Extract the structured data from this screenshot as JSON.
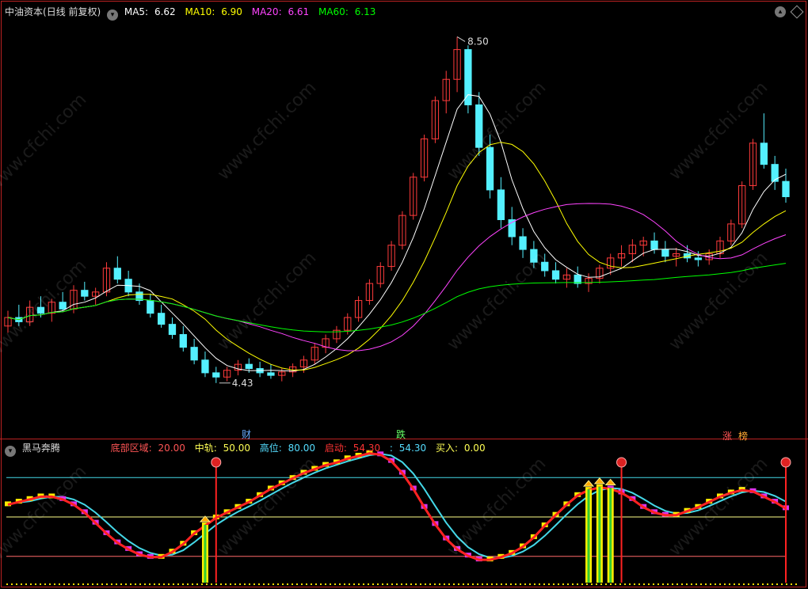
{
  "upper": {
    "title": "中油资本",
    "mode": "(日线 前复权)",
    "ma": [
      {
        "label": "MA5:",
        "value": "6.62",
        "color": "#ffffff"
      },
      {
        "label": "MA10:",
        "value": "6.90",
        "color": "#ffff00"
      },
      {
        "label": "MA20:",
        "value": "6.61",
        "color": "#ff44ff"
      },
      {
        "label": "MA60:",
        "value": "6.13",
        "color": "#00ff00"
      }
    ],
    "annotations": {
      "high": "8.50",
      "low": "4.43"
    },
    "markers": [
      "财",
      "跌",
      "涨",
      "榜"
    ]
  },
  "lower": {
    "title": "黑马奔腾",
    "params": [
      {
        "label": "底部区域:",
        "value": "20.00",
        "color": "#ff5555"
      },
      {
        "label": "中轨:",
        "value": "50.00",
        "color": "#ffff55"
      },
      {
        "label": "高位:",
        "value": "80.00",
        "color": "#55ddff"
      },
      {
        "label": "启动:",
        "value": "54.30",
        "color": "#ff3333"
      },
      {
        "label": ":",
        "value": "54.30",
        "color": "#55ddff"
      },
      {
        "label": "买入:",
        "value": "0.00",
        "color": "#ffff55"
      }
    ]
  },
  "watermark": "www.cfchi.com",
  "chart_data": [
    {
      "type": "candlestick",
      "title": "中油资本 (日线 前复权)",
      "ylim": [
        4.0,
        8.7
      ],
      "annotations": [
        {
          "label": "8.50",
          "value": 8.5
        },
        {
          "label": "4.43",
          "value": 4.43
        }
      ],
      "ohlc": [
        [
          5.1,
          5.28,
          5.02,
          5.2
        ],
        [
          5.2,
          5.35,
          5.1,
          5.15
        ],
        [
          5.15,
          5.4,
          5.1,
          5.32
        ],
        [
          5.32,
          5.45,
          5.2,
          5.25
        ],
        [
          5.25,
          5.42,
          5.15,
          5.38
        ],
        [
          5.38,
          5.5,
          5.28,
          5.3
        ],
        [
          5.3,
          5.58,
          5.25,
          5.52
        ],
        [
          5.52,
          5.62,
          5.4,
          5.45
        ],
        [
          5.45,
          5.55,
          5.35,
          5.5
        ],
        [
          5.5,
          5.85,
          5.45,
          5.78
        ],
        [
          5.78,
          5.92,
          5.6,
          5.65
        ],
        [
          5.65,
          5.75,
          5.45,
          5.5
        ],
        [
          5.5,
          5.6,
          5.35,
          5.4
        ],
        [
          5.4,
          5.48,
          5.2,
          5.25
        ],
        [
          5.25,
          5.35,
          5.08,
          5.12
        ],
        [
          5.12,
          5.2,
          4.95,
          5.0
        ],
        [
          5.0,
          5.1,
          4.8,
          4.85
        ],
        [
          4.85,
          4.95,
          4.65,
          4.7
        ],
        [
          4.7,
          4.8,
          4.5,
          4.55
        ],
        [
          4.55,
          4.62,
          4.43,
          4.5
        ],
        [
          4.5,
          4.62,
          4.45,
          4.58
        ],
        [
          4.58,
          4.7,
          4.52,
          4.65
        ],
        [
          4.65,
          4.72,
          4.55,
          4.6
        ],
        [
          4.6,
          4.68,
          4.5,
          4.55
        ],
        [
          4.55,
          4.65,
          4.48,
          4.52
        ],
        [
          4.52,
          4.6,
          4.45,
          4.56
        ],
        [
          4.56,
          4.66,
          4.5,
          4.62
        ],
        [
          4.62,
          4.75,
          4.55,
          4.7
        ],
        [
          4.7,
          4.9,
          4.65,
          4.85
        ],
        [
          4.85,
          5.0,
          4.78,
          4.95
        ],
        [
          4.95,
          5.1,
          4.9,
          5.05
        ],
        [
          5.05,
          5.25,
          5.0,
          5.2
        ],
        [
          5.2,
          5.45,
          5.15,
          5.4
        ],
        [
          5.4,
          5.65,
          5.35,
          5.6
        ],
        [
          5.6,
          5.85,
          5.55,
          5.8
        ],
        [
          5.8,
          6.1,
          5.75,
          6.05
        ],
        [
          6.05,
          6.45,
          6.0,
          6.4
        ],
        [
          6.4,
          6.9,
          6.35,
          6.85
        ],
        [
          6.85,
          7.35,
          6.8,
          7.3
        ],
        [
          7.3,
          7.8,
          7.25,
          7.75
        ],
        [
          7.75,
          8.1,
          7.6,
          8.0
        ],
        [
          8.0,
          8.5,
          7.85,
          8.35
        ],
        [
          8.35,
          8.4,
          7.6,
          7.7
        ],
        [
          7.7,
          7.85,
          7.1,
          7.2
        ],
        [
          7.2,
          7.35,
          6.6,
          6.7
        ],
        [
          6.7,
          6.85,
          6.25,
          6.35
        ],
        [
          6.35,
          6.5,
          6.05,
          6.15
        ],
        [
          6.15,
          6.25,
          5.9,
          6.0
        ],
        [
          6.0,
          6.1,
          5.78,
          5.85
        ],
        [
          5.85,
          5.95,
          5.68,
          5.75
        ],
        [
          5.75,
          5.85,
          5.6,
          5.65
        ],
        [
          5.65,
          5.78,
          5.55,
          5.7
        ],
        [
          5.7,
          5.8,
          5.55,
          5.6
        ],
        [
          5.6,
          5.72,
          5.5,
          5.66
        ],
        [
          5.66,
          5.82,
          5.6,
          5.78
        ],
        [
          5.78,
          5.95,
          5.7,
          5.9
        ],
        [
          5.9,
          6.05,
          5.8,
          5.95
        ],
        [
          5.95,
          6.12,
          5.85,
          6.05
        ],
        [
          6.05,
          6.15,
          5.92,
          6.1
        ],
        [
          6.1,
          6.2,
          5.95,
          6.0
        ],
        [
          6.0,
          6.1,
          5.85,
          5.92
        ],
        [
          5.92,
          6.02,
          5.8,
          5.95
        ],
        [
          5.95,
          6.05,
          5.85,
          5.9
        ],
        [
          5.9,
          5.98,
          5.8,
          5.88
        ],
        [
          5.88,
          6.0,
          5.82,
          5.95
        ],
        [
          5.95,
          6.15,
          5.9,
          6.1
        ],
        [
          6.1,
          6.35,
          6.05,
          6.3
        ],
        [
          6.3,
          6.8,
          6.25,
          6.75
        ],
        [
          6.75,
          7.3,
          6.7,
          7.25
        ],
        [
          7.25,
          7.6,
          6.95,
          7.0
        ],
        [
          7.0,
          7.1,
          6.7,
          6.8
        ],
        [
          6.8,
          6.95,
          6.55,
          6.62
        ]
      ]
    },
    {
      "type": "line",
      "title": "黑马奔腾",
      "ylim": [
        0,
        100
      ],
      "reference_lines": [
        20.0,
        50.0,
        80.0
      ],
      "series": [
        {
          "name": "启动",
          "values": [
            60,
            62,
            64,
            66,
            66,
            64,
            60,
            54,
            46,
            38,
            31,
            26,
            22,
            20,
            20,
            24,
            30,
            38,
            44,
            50,
            54,
            58,
            62,
            67,
            72,
            76,
            80,
            84,
            87,
            90,
            92,
            95,
            97,
            99,
            98,
            93,
            84,
            72,
            58,
            45,
            34,
            26,
            21,
            18,
            18,
            20,
            23,
            28,
            35,
            44,
            52,
            60,
            67,
            71,
            73,
            72,
            69,
            64,
            58,
            54,
            52,
            52,
            55,
            58,
            62,
            66,
            69,
            71,
            70,
            66,
            62,
            57
          ]
        }
      ],
      "buy_signals": [
        18,
        53,
        54,
        55
      ]
    }
  ]
}
